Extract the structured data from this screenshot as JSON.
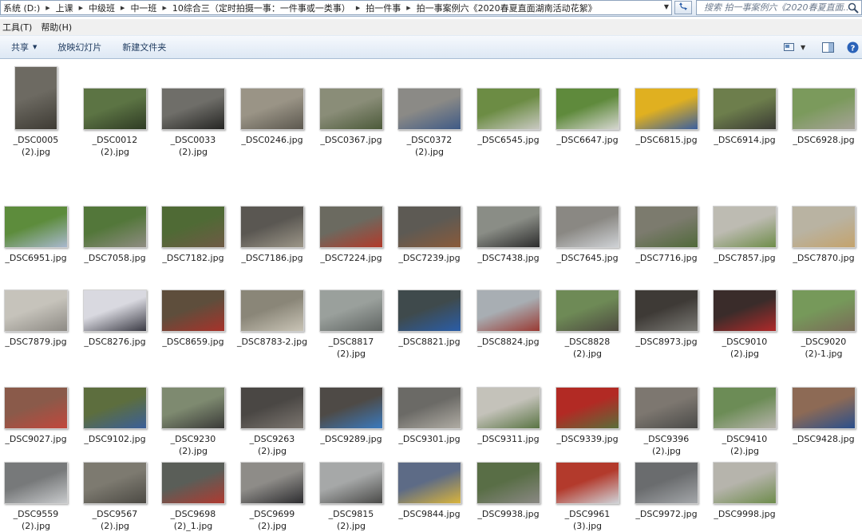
{
  "address_bar": {
    "breadcrumbs": [
      "系统 (D:)",
      "上课",
      "中级班",
      "中一班",
      "10综合三（定时拍摄一事：一件事或一类事）",
      "拍一件事",
      "拍一事案例六《2020春夏直面湖南活动花絮》"
    ],
    "search_placeholder": "搜索 拍一事案例六《2020春夏直面..."
  },
  "menu": {
    "items": [
      "工具(T)",
      "帮助(H)"
    ]
  },
  "commands": {
    "share": "共享",
    "slideshow": "放映幻灯片",
    "new_folder": "新建文件夹"
  },
  "colors": {
    "accent": "#2a5da8",
    "toolbar": "#dde8f4"
  },
  "files": [
    {
      "line1": "_DSC0005",
      "line2": "(2).jpg",
      "portrait": true,
      "c1": "#6d6a62",
      "c2": "#3e3b34"
    },
    {
      "line1": "_DSC0012",
      "line2": "(2).jpg",
      "c1": "#5c7444",
      "c2": "#2f3b24"
    },
    {
      "line1": "_DSC0033",
      "line2": "(2).jpg",
      "c1": "#6f6e69",
      "c2": "#262624"
    },
    {
      "line1": "_DSC0246.jpg",
      "c1": "#9a9486",
      "c2": "#5c584f"
    },
    {
      "line1": "_DSC0367.jpg",
      "c1": "#8a8d78",
      "c2": "#4c5a3a"
    },
    {
      "line1": "_DSC0372",
      "line2": "(2).jpg",
      "c1": "#8b8a86",
      "c2": "#3f5a86"
    },
    {
      "line1": "_DSC6545.jpg",
      "c1": "#6c8c44",
      "c2": "#c9c9c2"
    },
    {
      "line1": "_DSC6647.jpg",
      "c1": "#5f8a3c",
      "c2": "#d6d6d0"
    },
    {
      "line1": "_DSC6815.jpg",
      "c1": "#e0b020",
      "c2": "#3a5fa0"
    },
    {
      "line1": "_DSC6914.jpg",
      "c1": "#6d7e4c",
      "c2": "#3a3a34"
    },
    {
      "line1": "_DSC6928.jpg",
      "c1": "#7b9a5c",
      "c2": "#a7a399"
    },
    {
      "line1": "_DSC6951.jpg",
      "c1": "#5d8c3c",
      "c2": "#a9b8cf"
    },
    {
      "line1": "_DSC7058.jpg",
      "c1": "#53773a",
      "c2": "#8f8c82"
    },
    {
      "line1": "_DSC7182.jpg",
      "c1": "#4f6a35",
      "c2": "#6f5a45"
    },
    {
      "line1": "_DSC7186.jpg",
      "c1": "#5a5752",
      "c2": "#9c9688"
    },
    {
      "line1": "_DSC7224.jpg",
      "c1": "#6b6a60",
      "c2": "#b33a2a"
    },
    {
      "line1": "_DSC7239.jpg",
      "c1": "#5d5a54",
      "c2": "#8a5a3a"
    },
    {
      "line1": "_DSC7438.jpg",
      "c1": "#8a8d86",
      "c2": "#2d2d2d"
    },
    {
      "line1": "_DSC7645.jpg",
      "c1": "#8a8883",
      "c2": "#cfd2d6"
    },
    {
      "line1": "_DSC7716.jpg",
      "c1": "#7c7b6e",
      "c2": "#516a3a"
    },
    {
      "line1": "_DSC7857.jpg",
      "c1": "#bdbbb2",
      "c2": "#6f8d4a"
    },
    {
      "line1": "_DSC7870.jpg",
      "c1": "#b9b3a2",
      "c2": "#c4a36c"
    },
    {
      "line1": "_DSC7879.jpg",
      "c1": "#c6c3bb",
      "c2": "#8d8a84"
    },
    {
      "line1": "_DSC8276.jpg",
      "c1": "#d9d9e0",
      "c2": "#3a3a44"
    },
    {
      "line1": "_DSC8659.jpg",
      "c1": "#5e4e3c",
      "c2": "#a8322a"
    },
    {
      "line1": "_DSC8783-2.jpg",
      "c1": "#8a8678",
      "c2": "#c9c4b6"
    },
    {
      "line1": "_DSC8817",
      "line2": "(2).jpg",
      "c1": "#9aa09c",
      "c2": "#5f6462"
    },
    {
      "line1": "_DSC8821.jpg",
      "c1": "#3f4a4c",
      "c2": "#2a5da8"
    },
    {
      "line1": "_DSC8824.jpg",
      "c1": "#a8aeb3",
      "c2": "#9a3a33"
    },
    {
      "line1": "_DSC8828",
      "line2": "(2).jpg",
      "c1": "#6e8a56",
      "c2": "#4d4a40"
    },
    {
      "line1": "_DSC8973.jpg",
      "c1": "#3e3a36",
      "c2": "#7b7a75"
    },
    {
      "line1": "_DSC9010",
      "line2": "(2).jpg",
      "c1": "#3a2c2a",
      "c2": "#b02a2a"
    },
    {
      "line1": "_DSC9020",
      "line2": "(2)-1.jpg",
      "c1": "#76995a",
      "c2": "#7a6b58"
    },
    {
      "line1": "_DSC9027.jpg",
      "c1": "#8a5a4a",
      "c2": "#c2473c"
    },
    {
      "line1": "_DSC9102.jpg",
      "c1": "#5d6e3e",
      "c2": "#3a5f9a"
    },
    {
      "line1": "_DSC9230",
      "line2": "(2).jpg",
      "c1": "#7e8a70",
      "c2": "#3a3a38"
    },
    {
      "line1": "_DSC9263",
      "line2": "(2).jpg",
      "c1": "#4a4744",
      "c2": "#7c7670"
    },
    {
      "line1": "_DSC9289.jpg",
      "c1": "#4e4a46",
      "c2": "#3a7abf"
    },
    {
      "line1": "_DSC9301.jpg",
      "c1": "#6b6a66",
      "c2": "#b0aca4"
    },
    {
      "line1": "_DSC9311.jpg",
      "c1": "#c4c2ba",
      "c2": "#5a7444"
    },
    {
      "line1": "_DSC9339.jpg",
      "c1": "#b22a24",
      "c2": "#5a6e3a"
    },
    {
      "line1": "_DSC9396",
      "line2": "(2).jpg",
      "c1": "#7d7770",
      "c2": "#4a4a48"
    },
    {
      "line1": "_DSC9410",
      "line2": "(2).jpg",
      "c1": "#6c8c56",
      "c2": "#b7b4ac"
    },
    {
      "line1": "_DSC9428.jpg",
      "c1": "#8d6a55",
      "c2": "#2a4f8c"
    },
    {
      "line1": "_DSC9559",
      "line2": "(2).jpg",
      "c1": "#77797a",
      "c2": "#c8cacc"
    },
    {
      "line1": "_DSC9567",
      "line2": "(2).jpg",
      "c1": "#7d7a70",
      "c2": "#4c4a44"
    },
    {
      "line1": "_DSC9698",
      "line2": "(2)_1.jpg",
      "c1": "#5a5e58",
      "c2": "#b03a30"
    },
    {
      "line1": "_DSC9699",
      "line2": "(2).jpg",
      "c1": "#8e8c88",
      "c2": "#2d2d30"
    },
    {
      "line1": "_DSC9815",
      "line2": "(2).jpg",
      "c1": "#a6a8a8",
      "c2": "#4a4a48"
    },
    {
      "line1": "_DSC9844.jpg",
      "c1": "#5d6b86",
      "c2": "#d9b43c"
    },
    {
      "line1": "_DSC9938.jpg",
      "c1": "#596e46",
      "c2": "#8a8884"
    },
    {
      "line1": "_DSC9961",
      "line2": "(3).jpg",
      "c1": "#b33a2c",
      "c2": "#cfd3d8"
    },
    {
      "line1": "_DSC9972.jpg",
      "c1": "#6a6c6e",
      "c2": "#a3a6a9"
    },
    {
      "line1": "_DSC9998.jpg",
      "c1": "#b6b4ac",
      "c2": "#6e8c4c"
    }
  ]
}
